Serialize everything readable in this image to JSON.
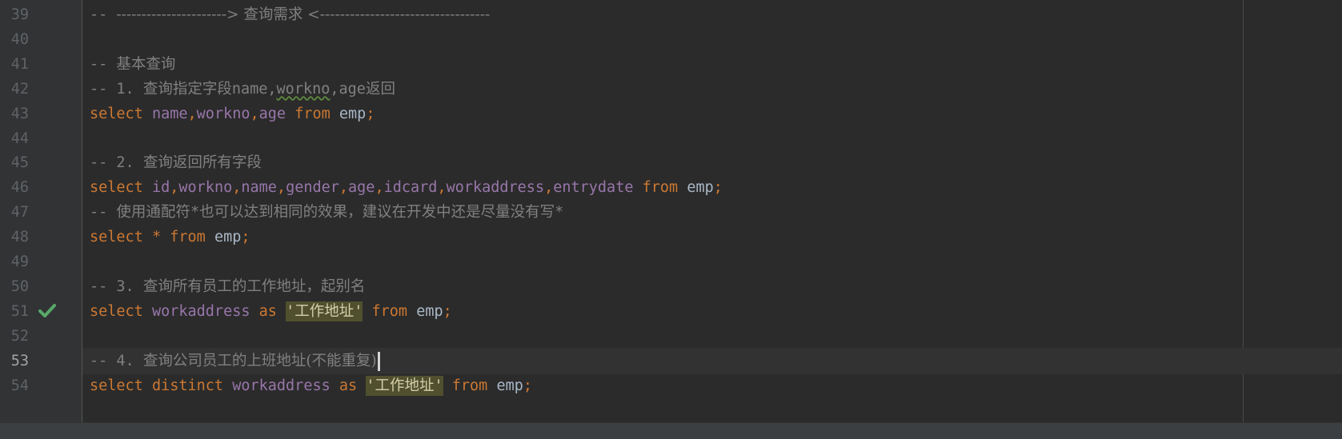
{
  "editor": {
    "lines": [
      {
        "num": "39",
        "text": "-- ----------------------> 查询需求 <----------------------------------"
      },
      {
        "num": "40",
        "text": ""
      },
      {
        "num": "41",
        "text": "-- 基本查询"
      },
      {
        "num": "42",
        "text": "-- 1. 查询指定字段name,workno,age返回"
      },
      {
        "num": "43",
        "text": "select name,workno,age from emp;"
      },
      {
        "num": "44",
        "text": ""
      },
      {
        "num": "45",
        "text": "-- 2. 查询返回所有字段"
      },
      {
        "num": "46",
        "text": "select id,workno,name,gender,age,idcard,workaddress,entrydate from emp;"
      },
      {
        "num": "47",
        "text": "-- 使用通配符*也可以达到相同的效果，建议在开发中还是尽量没有写*"
      },
      {
        "num": "48",
        "text": "select * from emp;"
      },
      {
        "num": "49",
        "text": ""
      },
      {
        "num": "50",
        "text": "-- 3. 查询所有员工的工作地址，起别名"
      },
      {
        "num": "51",
        "text": "select workaddress as '工作地址' from emp;"
      },
      {
        "num": "52",
        "text": ""
      },
      {
        "num": "53",
        "text": "-- 4. 查询公司员工的上班地址(不能重复)"
      },
      {
        "num": "54",
        "text": "select distinct workaddress as '工作地址' from emp;"
      }
    ],
    "current_line": "53",
    "run_marker_line": "51",
    "run_marker_icon": "checkmark-icon",
    "colors": {
      "background": "#2b2b2b",
      "gutter": "#313335",
      "keyword": "#cc7832",
      "column": "#9876aa",
      "comment": "#808080",
      "identifier": "#a9b7c6",
      "string_highlight": "#50502f",
      "run_marker": "#59a869"
    }
  }
}
